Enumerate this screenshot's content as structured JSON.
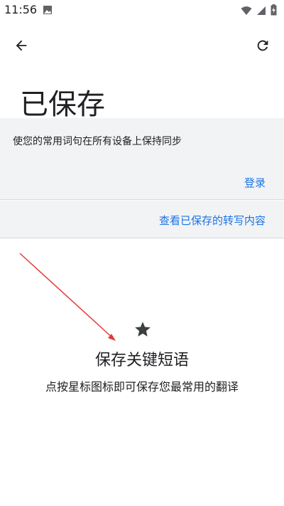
{
  "status_bar": {
    "time": "11:56",
    "icons": [
      "gallery-icon",
      "wifi-icon",
      "signal-icon",
      "battery-charging-icon"
    ]
  },
  "toolbar": {
    "back_icon": "back-arrow-icon",
    "refresh_icon": "refresh-icon"
  },
  "page": {
    "title": "已保存"
  },
  "sync_card": {
    "message": "使您的常用词句在所有设备上保持同步",
    "login_label": "登录"
  },
  "transcripts": {
    "link_label": "查看已保存的转写内容"
  },
  "empty_state": {
    "icon": "star-icon",
    "title": "保存关键短语",
    "description": "点按星标图标即可保存您最常用的翻译"
  },
  "colors": {
    "accent": "#1a73e8",
    "card_bg": "#f1f3f4",
    "annotation": "#e53935"
  }
}
